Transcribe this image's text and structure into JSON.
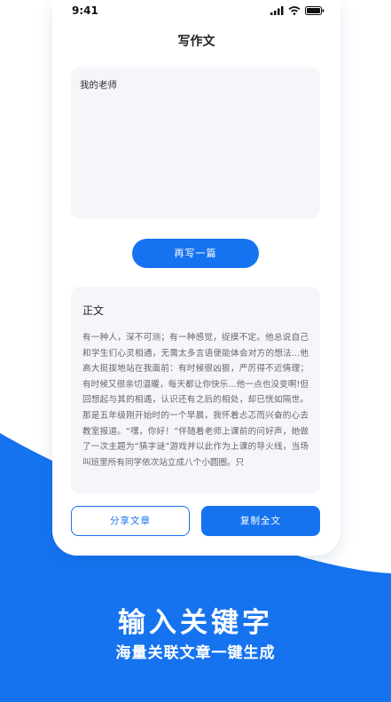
{
  "colors": {
    "accent": "#1673f0",
    "card_bg": "#f4f6fa"
  },
  "status_bar": {
    "time": "9:41",
    "icons": [
      "signal-icon",
      "wifi-icon",
      "battery-icon"
    ]
  },
  "header": {
    "title": "写作文"
  },
  "input": {
    "value": "我的老师"
  },
  "rewrite_button": {
    "label": "再写一篇"
  },
  "result": {
    "title": "正文",
    "body": "有一种人，深不可测；有一种感觉，捉摸不定。他总说自己和学生们心灵相通，无需太多言语便能体会对方的想法...他高大挺拔地站在我面前：有时候很凶狠，严厉得不近情理；有时候又很亲切温暖，每天都让你快乐...他一点也没变啊!但回想起与其的相遇，认识还有之后的相处，却已恍如隔世。那是五年级刚开始时的一个早晨，我怀着忐忑而兴奋的心去教室报道。“嘿，你好！”伴随着老师上课前的问好声，她做了一次主题为“猜字谜”游戏并以此作为上课的导火线，当场叫班里所有同学依次站立成八个小圆圈。只"
  },
  "share_button": {
    "label": "分享文章"
  },
  "copy_button": {
    "label": "复制全文"
  },
  "promo": {
    "headline": "输入关键字",
    "subheadline": "海量关联文章一键生成"
  }
}
